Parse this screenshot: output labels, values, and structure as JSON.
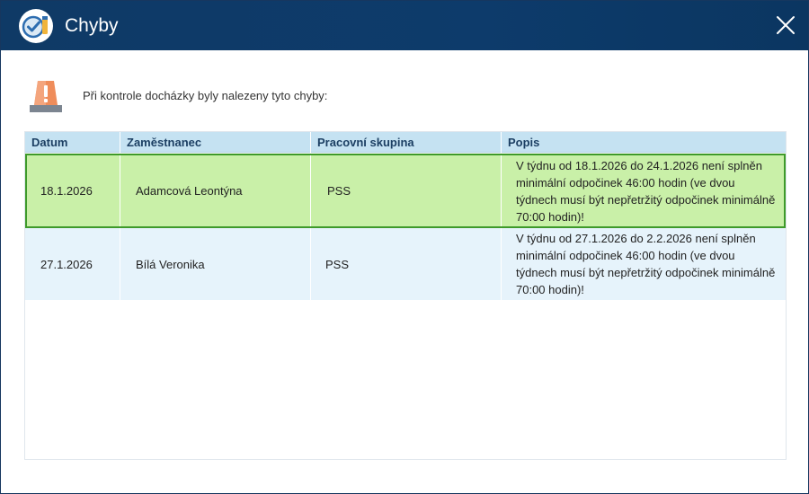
{
  "window": {
    "title": "Chyby",
    "app_icon": "check-badge-icon",
    "close_icon": "close-icon"
  },
  "message": {
    "icon": "warning-beacon-icon",
    "text": "Při kontrole docházky byly nalezeny tyto chyby:"
  },
  "table": {
    "headers": {
      "datum": "Datum",
      "zamestnanec": "Zaměstnanec",
      "skupina": "Pracovní skupina",
      "popis": "Popis"
    },
    "rows": [
      {
        "datum": "18.1.2026",
        "zamestnanec": "Adamcová Leontýna",
        "skupina": "PSS",
        "popis": "V týdnu od 18.1.2026 do 24.1.2026 není splněn minimální odpočinek 46:00 hodin (ve dvou týdnech musí být nepřetržitý odpočinek minimálně 70:00 hodin)!"
      },
      {
        "datum": "27.1.2026",
        "zamestnanec": "Bílá Veronika",
        "skupina": "PSS",
        "popis": "V týdnu od 27.1.2026 do 2.2.2026 není splněn minimální odpočinek 46:00 hodin (ve dvou týdnech musí být nepřetržitý odpočinek minimálně 70:00 hodin)!"
      }
    ]
  },
  "colors": {
    "titlebar": "#0f3a66",
    "header_bg": "#c5e2f2",
    "selected_row_bg": "#c9f0a8",
    "selected_row_border": "#3e9a2a",
    "row_bg": "#e6f3fb"
  }
}
